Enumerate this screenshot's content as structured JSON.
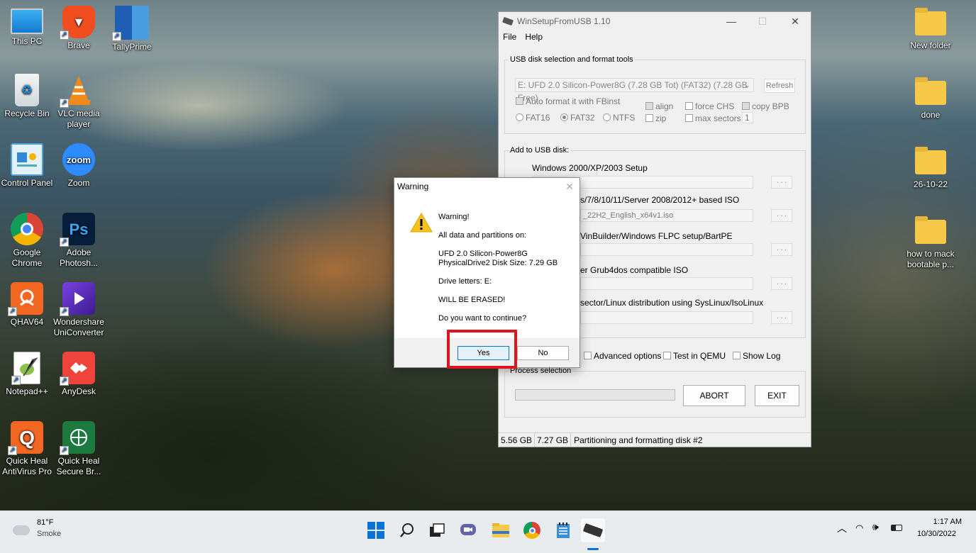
{
  "desktop": {
    "left_icons": [
      {
        "label": "This PC",
        "icon": "monitor-icon"
      },
      {
        "label": "Brave",
        "icon": "brave-icon"
      },
      {
        "label": "TallyPrime",
        "icon": "tallyprime-icon"
      },
      {
        "label": "Recycle Bin",
        "icon": "recycle-bin-icon"
      },
      {
        "label": "VLC media player",
        "icon": "vlc-icon"
      },
      {
        "label": "Control Panel",
        "icon": "control-panel-icon"
      },
      {
        "label": "Zoom",
        "icon": "zoom-icon",
        "glyph": "zoom"
      },
      {
        "label": "Google Chrome",
        "icon": "chrome-icon"
      },
      {
        "label": "Adobe Photosh...",
        "icon": "photoshop-icon",
        "glyph": "Ps"
      },
      {
        "label": "QHAV64",
        "icon": "qhav64-icon"
      },
      {
        "label": "Wondershare UniConverter",
        "icon": "uniconverter-icon"
      },
      {
        "label": "Notepad++",
        "icon": "notepadpp-icon"
      },
      {
        "label": "AnyDesk",
        "icon": "anydesk-icon"
      },
      {
        "label": "Quick Heal AntiVirus Pro",
        "icon": "quickheal-icon",
        "glyph": "Q"
      },
      {
        "label": "Quick Heal Secure Br...",
        "icon": "quickheal-browser-icon"
      }
    ],
    "right_icons": [
      {
        "label": "New folder",
        "icon": "folder-icon"
      },
      {
        "label": "done",
        "icon": "folder-icon"
      },
      {
        "label": "26-10-22",
        "icon": "folder-icon"
      },
      {
        "label": "how to mack bootable p...",
        "icon": "folder-icon"
      }
    ]
  },
  "main_window": {
    "title": "WinSetupFromUSB 1.10",
    "menu": [
      "File",
      "Help"
    ],
    "usb_group": {
      "title": "USB disk selection and format tools",
      "disk_select": "E: UFD 2.0 Silicon-Power8G (7.28 GB Tot) (FAT32) (7.28 GB Free)",
      "refresh": "Refresh",
      "auto_format": "Auto format it with FBinst",
      "fat16": "FAT16",
      "fat32": "FAT32",
      "ntfs": "NTFS",
      "align": "align",
      "zip": "zip",
      "force_chs": "force CHS",
      "max_sectors": "max sectors",
      "copy_bpb": "copy BPB",
      "max_sectors_value": "1"
    },
    "add_group": {
      "title": "Add to USB disk:",
      "items": [
        {
          "label": "Windows 2000/XP/2003 Setup",
          "path": ""
        },
        {
          "label": "s/7/8/10/11/Server 2008/2012+ based ISO",
          "path": "_22H2_English_x64v1.iso"
        },
        {
          "label": "VinBuilder/Windows FLPC setup/BartPE",
          "path": ""
        },
        {
          "label": "er Grub4dos compatible ISO",
          "path": ""
        },
        {
          "label": "sector/Linux distribution using SysLinux/IsoLinux",
          "path": ""
        }
      ],
      "browse": ". . ."
    },
    "advanced_options": "Advanced options",
    "test_qemu": "Test in QEMU",
    "show_log": "Show Log",
    "process_title": "Process selection",
    "abort": "ABORT",
    "exit": "EXIT",
    "status": {
      "left": "5.56 GB",
      "mid": "7.27 GB",
      "right": "Partitioning and formatting disk #2"
    }
  },
  "dialog": {
    "title": "Warning",
    "line1": "Warning!",
    "line2": "All data and partitions on:",
    "line3": "UFD 2.0 Silicon-Power8G",
    "line4": "PhysicalDrive2   Disk Size: 7.29 GB",
    "line5": "Drive letters:  E:",
    "line6": " WILL BE ERASED!",
    "line7": "Do you want to continue?",
    "yes": "Yes",
    "no": "No",
    "highlight_color": "#e0141e"
  },
  "taskbar": {
    "weather_temp": "81°F",
    "weather_desc": "Smoke",
    "apps": [
      "windows-start-icon",
      "search-icon",
      "task-view-icon",
      "chat-icon",
      "file-explorer-icon",
      "chrome-icon",
      "notepad-icon",
      "usb-app-icon"
    ],
    "time": "1:17 AM",
    "date": "10/30/2022"
  }
}
